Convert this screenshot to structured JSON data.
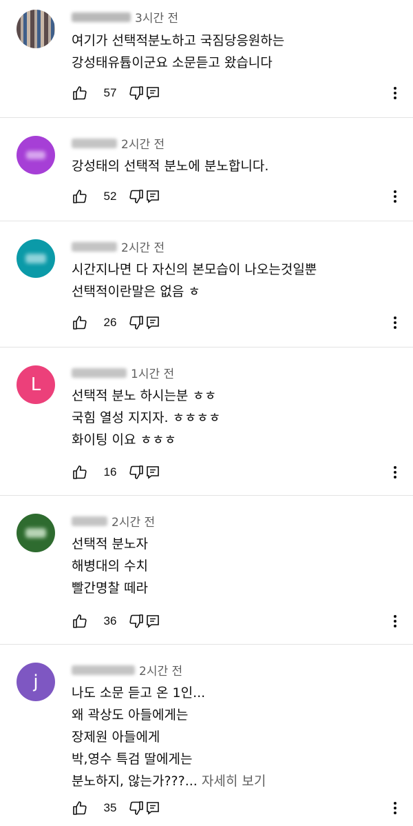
{
  "comments": [
    {
      "time": "3시간 전",
      "lines": [
        "여기가 선택적분노하고 국짐당응원하는",
        "강성태유튭이군요 소문듣고 왔습니다"
      ],
      "likes": "57",
      "avatar_color": "#8a7f7a",
      "avatar_text": ""
    },
    {
      "time": "2시간 전",
      "lines": [
        "강성태의 선택적 분노에 분노합니다."
      ],
      "likes": "52",
      "avatar_color": "#a63fd6",
      "avatar_text": ""
    },
    {
      "time": "2시간 전",
      "lines": [
        "시간지나면 다 자신의 본모습이 나오는것일뿐",
        "선택적이란말은 없음 ㅎ"
      ],
      "likes": "26",
      "avatar_color": "#0b9aa8",
      "avatar_text": ""
    },
    {
      "time": "1시간 전",
      "lines": [
        "선택적 분노 하시는분 ㅎㅎ",
        "국힘 열성 지지자. ㅎㅎㅎㅎ",
        "화이팅 이요 ㅎㅎㅎ"
      ],
      "likes": "16",
      "avatar_color": "#ec407a",
      "avatar_text": "L"
    },
    {
      "time": "2시간 전",
      "lines": [
        "선택적 분노자",
        "해병대의 수치",
        "빨간명찰 떼라"
      ],
      "likes": "36",
      "avatar_color": "#2e6b2f",
      "avatar_text": ""
    },
    {
      "time": "2시간 전",
      "lines": [
        "나도 소문 듣고 온 1인...",
        "왜 곽상도 아들에게는",
        "장제원 아들에게",
        "박,영수 특검 딸에게는",
        "분노하지, 않는가???..."
      ],
      "more": "자세히 보기",
      "likes": "35",
      "avatar_color": "#7e57c2",
      "avatar_text": "j"
    }
  ],
  "icons": {
    "like": "thumb-up-icon",
    "dislike": "thumb-down-icon",
    "reply": "reply-icon",
    "menu": "more-vert-icon"
  }
}
